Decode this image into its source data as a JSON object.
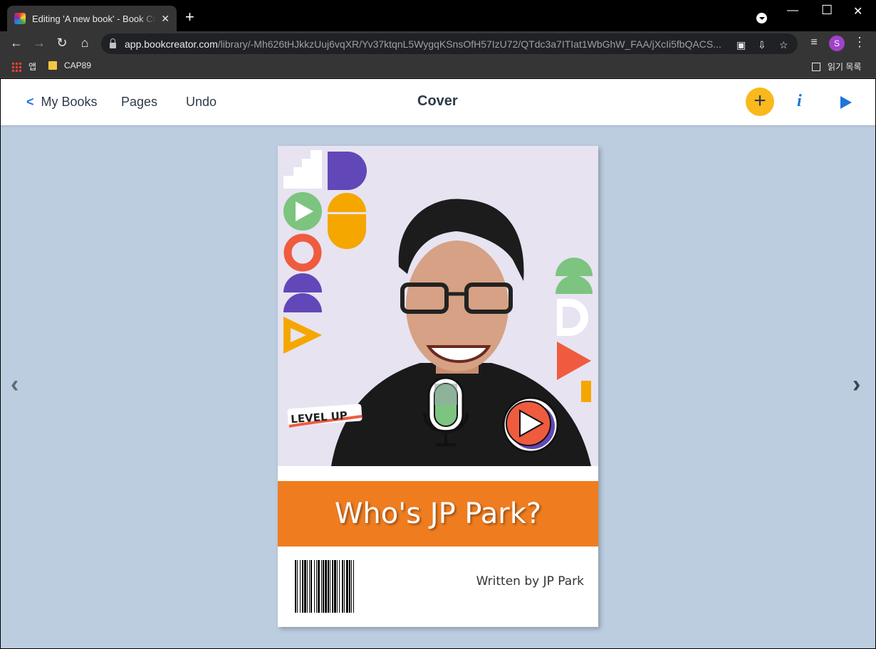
{
  "browser": {
    "tab": {
      "title": "Editing 'A new book' - Book Creator"
    },
    "address": {
      "host": "app.bookcreator.com",
      "path": "/library/-Mh626tHJkkzUuj6vqXR/Yv37ktqnL5WygqKSnsOfH57IzU72/QTdc3a7ITIat1WbGhW_FAA/jXcIi5fbQACS..."
    },
    "profile_initial": "S",
    "bookmarks": [
      {
        "label": "앱"
      },
      {
        "label": "CAP89"
      }
    ],
    "reading_list": "읽기 목록"
  },
  "header": {
    "back_label": "My Books",
    "pages_label": "Pages",
    "undo_label": "Undo",
    "title": "Cover"
  },
  "book": {
    "title": "Who's JP Park?",
    "author": "Written by JP Park",
    "sticker_text": "LEVEL UP"
  },
  "colors": {
    "accent_blue": "#1e74d8",
    "add_button": "#f9b81c",
    "title_band": "#ef7d20",
    "canvas_bg": "#bccde0"
  }
}
